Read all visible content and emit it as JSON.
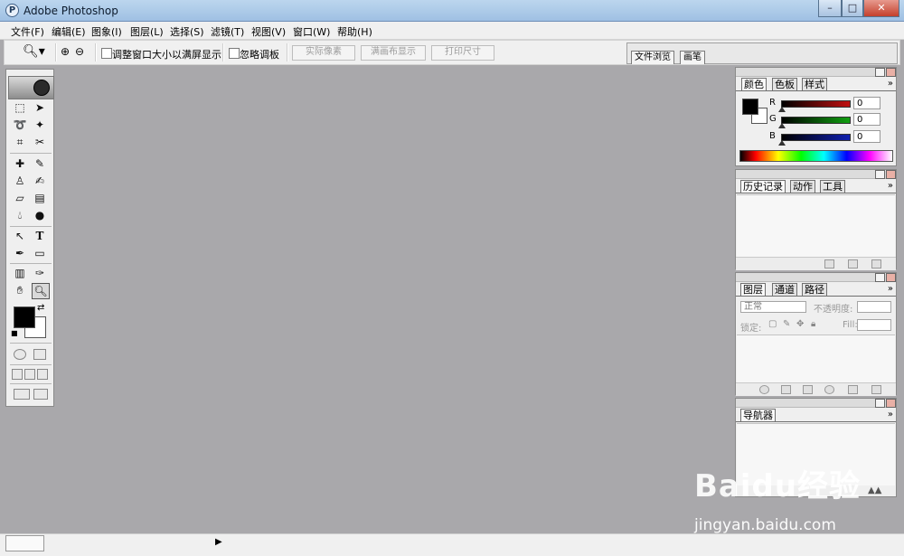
{
  "window": {
    "title": "Adobe Photoshop",
    "app_icon": "ps-icon",
    "controls": [
      "minimize",
      "maximize",
      "close"
    ]
  },
  "menu": [
    "文件(F)",
    "编辑(E)",
    "图象(I)",
    "图层(L)",
    "选择(S)",
    "滤镜(T)",
    "视图(V)",
    "窗口(W)",
    "帮助(H)"
  ],
  "options": {
    "zoom_tool_icon": "zoom-icon",
    "check_resize_label": "调整窗口大小以满屏显示",
    "check_ignore_label": "忽略调板",
    "btn_actual": "实际像素",
    "btn_fit": "满画布显示",
    "btn_print": "打印尺寸",
    "well_tabs": [
      "文件浏览",
      "画笔"
    ]
  },
  "color_palette": {
    "tabs": [
      "颜色",
      "色板",
      "样式"
    ],
    "channels": [
      {
        "label": "R",
        "value": "0",
        "color": "#c01010"
      },
      {
        "label": "G",
        "value": "0",
        "color": "#10a010"
      },
      {
        "label": "B",
        "value": "0",
        "color": "#1020b0"
      }
    ]
  },
  "history_palette": {
    "tabs": [
      "历史记录",
      "动作",
      "工具"
    ]
  },
  "layers_palette": {
    "tabs": [
      "图层",
      "通道",
      "路径"
    ],
    "blend_mode": "正常",
    "opacity_label": "不透明度:",
    "lock_label": "锁定:",
    "fill_label": "Fill:"
  },
  "navigator_palette": {
    "tabs": [
      "导航器"
    ]
  },
  "watermark": {
    "logo_text": "Baidu经验",
    "url": "jingyan.baidu.com"
  }
}
